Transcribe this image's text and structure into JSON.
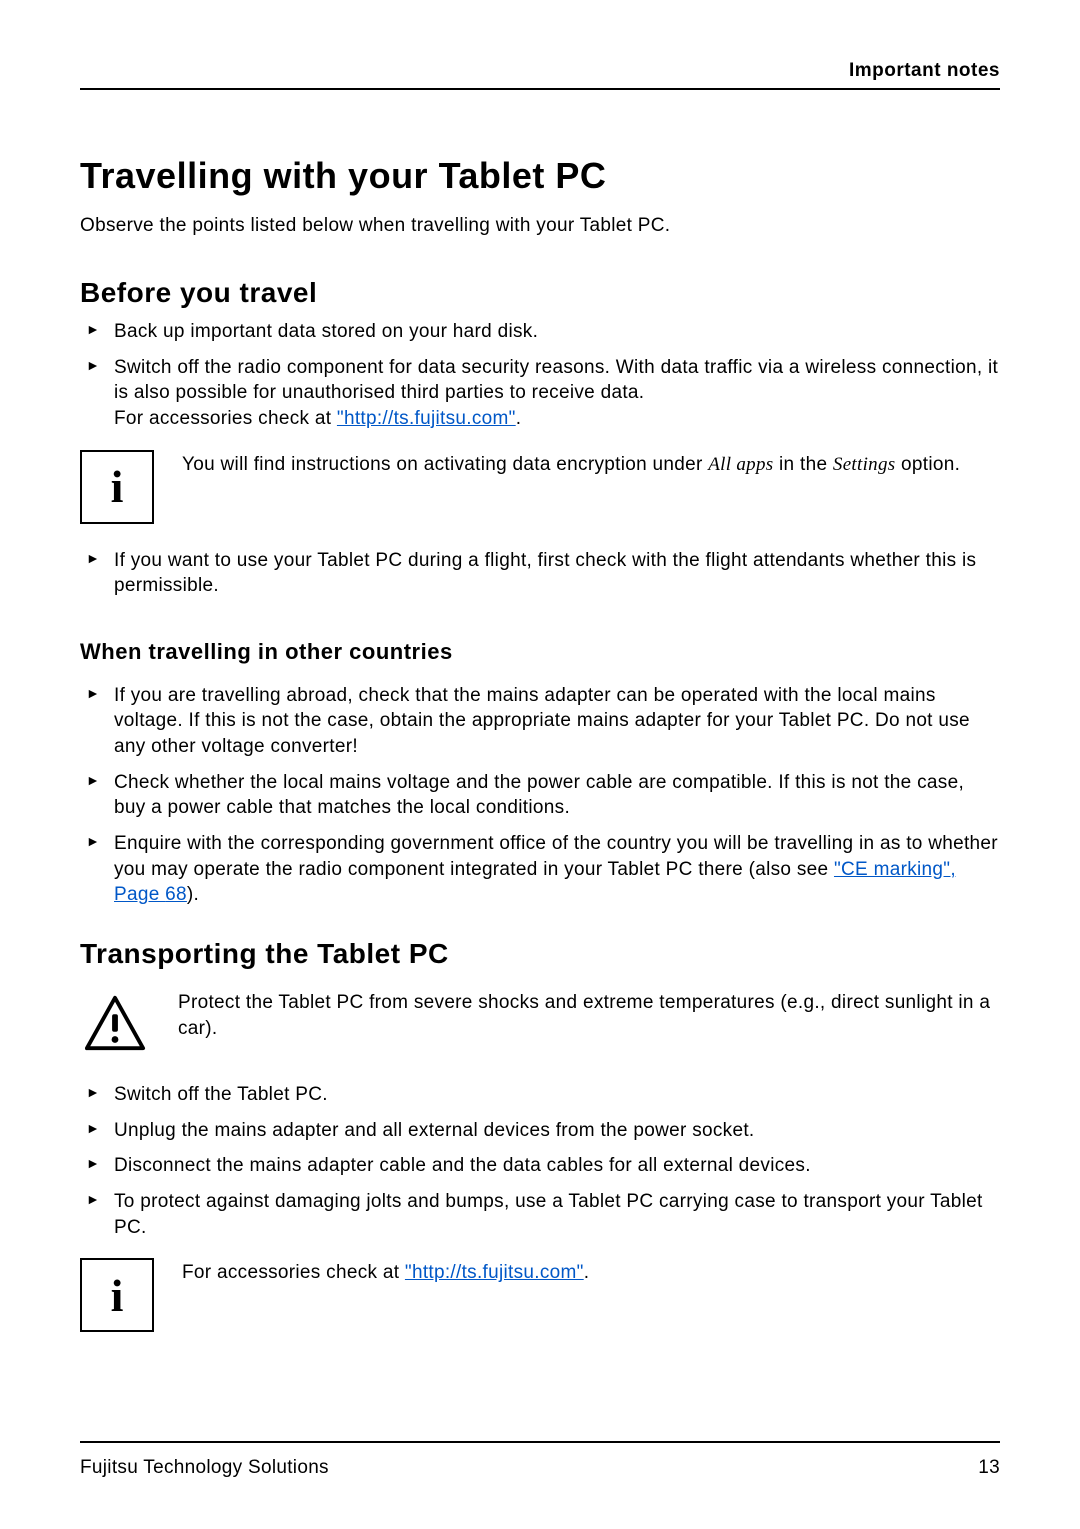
{
  "header": {
    "label": "Important notes"
  },
  "title": "Travelling with your Tablet PC",
  "intro": "Observe the points listed below when travelling with your Tablet PC.",
  "s1": {
    "heading": "Before you travel",
    "b1": "Back up important data stored on your hard disk.",
    "b2a": "Switch off the radio component for data security reasons. With data traffic via a wireless connection, it is also possible for unauthorised third parties to receive data.",
    "b2b_prefix": "For accessories check at ",
    "b2b_link": "\"http://ts.fujitsu.com\"",
    "b2b_suffix": ".",
    "note_pre": "You will find instructions on activating data encryption under ",
    "note_em1": "All apps",
    "note_mid": " in the ",
    "note_em2": "Settings",
    "note_post": " option.",
    "b3": "If you want to use your Tablet PC during a flight, first check with the flight attendants whether this is permissible."
  },
  "s1b": {
    "heading": "When travelling in other countries",
    "b1": "If you are travelling abroad, check that the mains adapter can be operated with the local mains voltage. If this is not the case, obtain the appropriate mains adapter for your Tablet PC. Do not use any other voltage converter!",
    "b2": "Check whether the local mains voltage and the power cable are compatible. If this is not the case, buy a power cable that matches the local conditions.",
    "b3_pre": "Enquire with the corresponding government office of the country you will be travelling in as to whether you may operate the radio component integrated in your Tablet PC there (also see ",
    "b3_link1": "\"CE marking\", Page ",
    "b3_link2": "68",
    "b3_post": ")."
  },
  "s2": {
    "heading": "Transporting the Tablet PC",
    "warn": "Protect the Tablet PC from severe shocks and extreme temperatures (e.g., direct sunlight in a car).",
    "b1": "Switch off the Tablet PC.",
    "b2": "Unplug the mains adapter and all external devices from the power socket.",
    "b3": "Disconnect the mains adapter cable and the data cables for all external devices.",
    "b4": "To protect against damaging jolts and bumps, use a Tablet PC carrying case to transport your Tablet PC.",
    "note_pre": "For accessories check at ",
    "note_link": "\"http://ts.fujitsu.com\"",
    "note_post": "."
  },
  "footer": {
    "left": "Fujitsu Technology Solutions",
    "right": "13"
  }
}
